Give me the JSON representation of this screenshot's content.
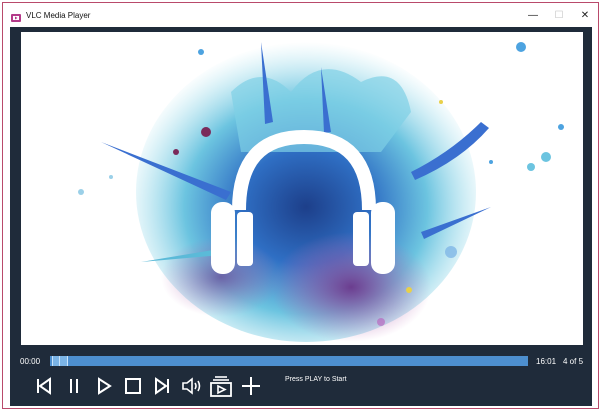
{
  "window": {
    "title": "VLC Media Player"
  },
  "window_controls": {
    "minimize": "—",
    "maximize": "☐",
    "close": "✕"
  },
  "player": {
    "current_time": "00:00",
    "total_time": "16:01",
    "track_position": "4 of 5",
    "status": "Press PLAY to Start",
    "progress": 0.0
  },
  "controls": [
    "previous-icon",
    "pause-icon",
    "play-icon",
    "stop-icon",
    "next-icon",
    "volume-icon",
    "playlist-icon",
    "add-icon"
  ],
  "colors": {
    "frame": "#1f2b3a",
    "seek": "#4d8fcf",
    "accent": "#b94a6b"
  }
}
